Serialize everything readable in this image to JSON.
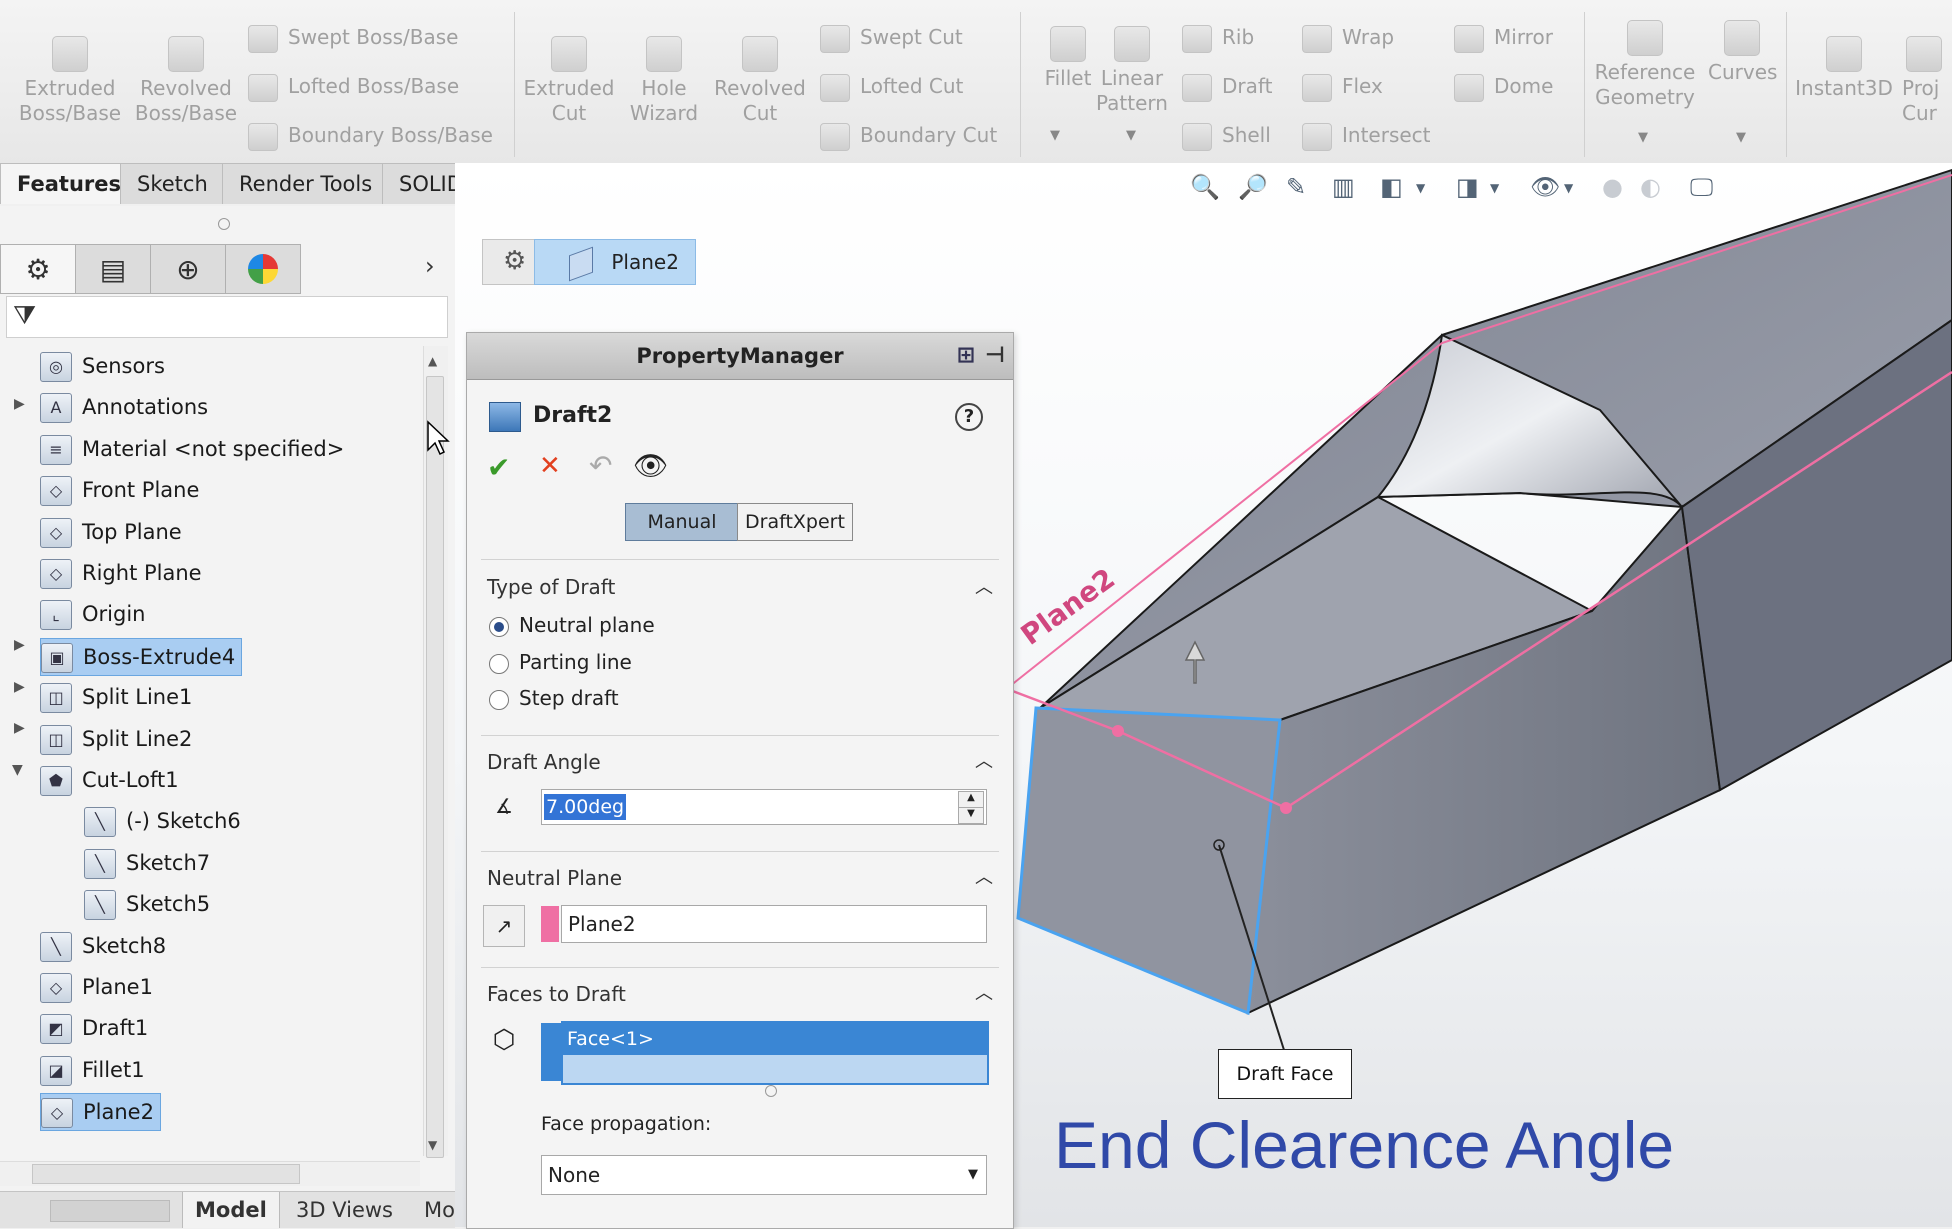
{
  "ribbon": {
    "extruded_boss": "Extruded Boss/Base",
    "revolved_boss": "Revolved Boss/Base",
    "swept_boss": "Swept Boss/Base",
    "lofted_boss": "Lofted Boss/Base",
    "boundary_boss": "Boundary Boss/Base",
    "extruded_cut": "Extruded Cut",
    "hole_wizard": "Hole Wizard",
    "revolved_cut": "Revolved Cut",
    "swept_cut": "Swept Cut",
    "lofted_cut": "Lofted Cut",
    "boundary_cut": "Boundary Cut",
    "fillet": "Fillet",
    "linear_pattern": "Linear Pattern",
    "rib": "Rib",
    "draft": "Draft",
    "shell": "Shell",
    "wrap": "Wrap",
    "flex": "Flex",
    "intersect": "Intersect",
    "mirror": "Mirror",
    "dome": "Dome",
    "reference_geometry": "Reference Geometry",
    "curves": "Curves",
    "instant3d": "Instant3D",
    "project_curve": "Proj Cur"
  },
  "tabs": [
    "Features",
    "Sketch",
    "Render Tools",
    "SOLIDWORKS Add-Ins"
  ],
  "tree": {
    "items": [
      {
        "label": "Sensors",
        "icon": "sensor-icon"
      },
      {
        "label": "Annotations",
        "icon": "annotation-icon"
      },
      {
        "label": "Material <not specified>",
        "icon": "material-icon"
      },
      {
        "label": "Front Plane",
        "icon": "plane-icon"
      },
      {
        "label": "Top Plane",
        "icon": "plane-icon"
      },
      {
        "label": "Right Plane",
        "icon": "plane-icon"
      },
      {
        "label": "Origin",
        "icon": "origin-icon"
      },
      {
        "label": "Boss-Extrude4",
        "icon": "extrude-icon"
      },
      {
        "label": "Split Line1",
        "icon": "split-line-icon"
      },
      {
        "label": "Split Line2",
        "icon": "split-line-icon"
      },
      {
        "label": "Cut-Loft1",
        "icon": "cut-loft-icon"
      },
      {
        "label": "(-) Sketch6",
        "icon": "sketch-icon"
      },
      {
        "label": "Sketch7",
        "icon": "sketch-icon"
      },
      {
        "label": "Sketch5",
        "icon": "sketch-icon"
      },
      {
        "label": "Sketch8",
        "icon": "sketch-icon"
      },
      {
        "label": "Plane1",
        "icon": "plane-icon"
      },
      {
        "label": "Draft1",
        "icon": "draft-icon"
      },
      {
        "label": "Fillet1",
        "icon": "fillet-icon"
      },
      {
        "label": "Plane2",
        "icon": "plane-icon"
      }
    ],
    "selected": [
      "Boss-Extrude4",
      "Plane2"
    ]
  },
  "bottom_tabs": [
    "Model",
    "3D Views",
    "Mot"
  ],
  "breadcrumb": {
    "item": "Plane2"
  },
  "property_manager": {
    "header": "PropertyManager",
    "feature_name": "Draft2",
    "mode_manual": "Manual",
    "mode_draftxpert": "DraftXpert",
    "type_of_draft": {
      "title": "Type of Draft",
      "options": [
        "Neutral plane",
        "Parting line",
        "Step draft"
      ],
      "selected": "Neutral plane"
    },
    "draft_angle": {
      "title": "Draft Angle",
      "value": "7.00deg"
    },
    "neutral_plane": {
      "title": "Neutral Plane",
      "value": "Plane2"
    },
    "faces_to_draft": {
      "title": "Faces to Draft",
      "value": "Face<1>"
    },
    "face_propagation": {
      "label": "Face propagation:",
      "value": "None"
    }
  },
  "viewport": {
    "plane_label": "Plane2",
    "callout": "Draft Face",
    "caption": "End Clearence Angle"
  },
  "colors": {
    "caption": "#3049a8",
    "plane": "#ef6fa3",
    "selected_face_edge": "#4aa3f0",
    "model_fill": "#8a8f9b"
  }
}
